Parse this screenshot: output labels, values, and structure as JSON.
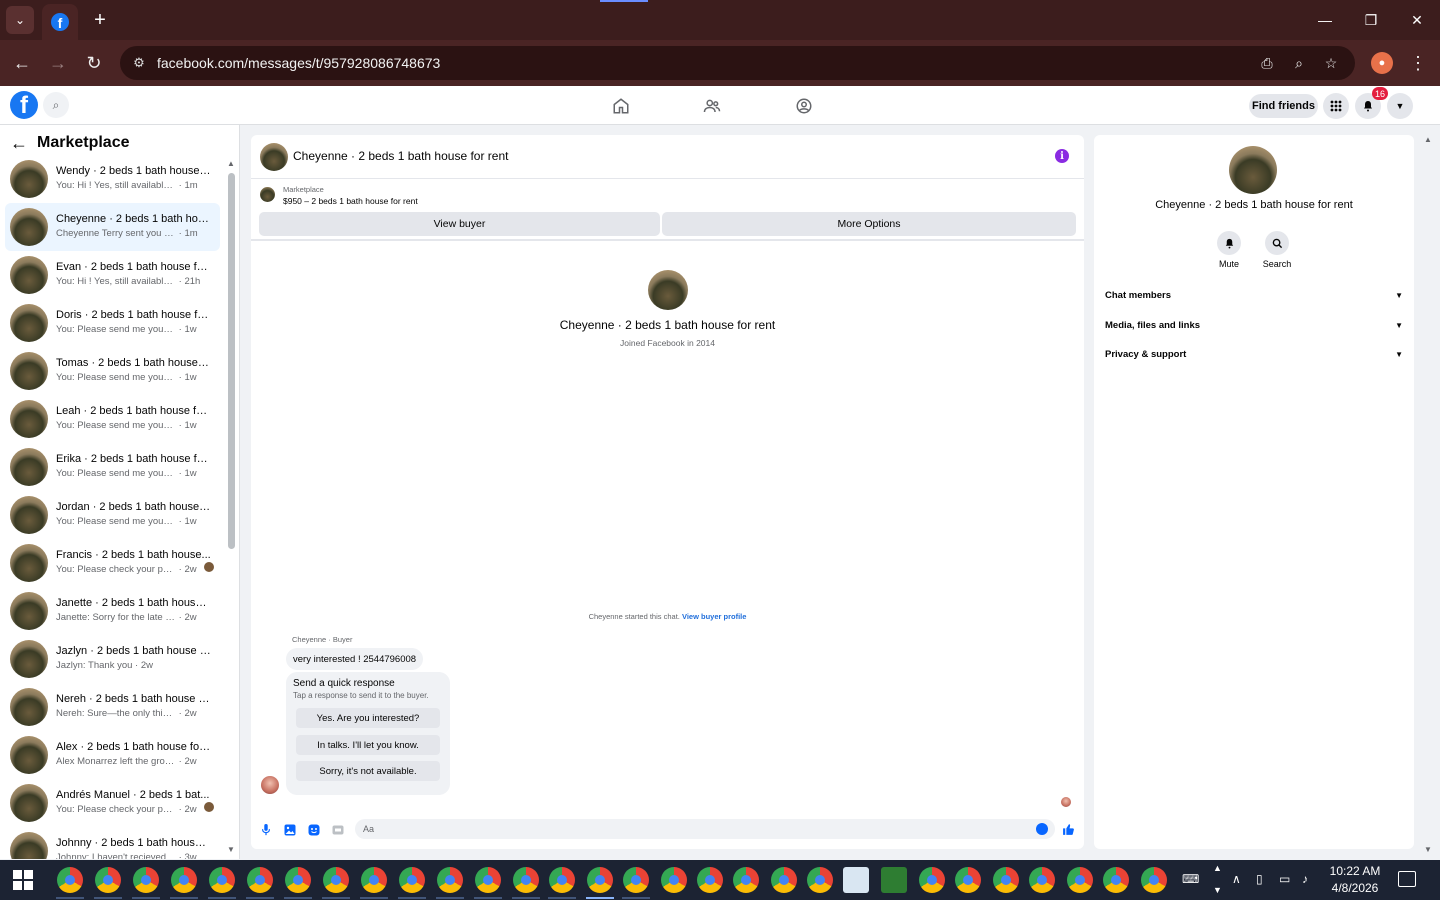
{
  "browser": {
    "url": "facebook.com/messages/t/957928086748673"
  },
  "fb": {
    "find_friends": "Find friends",
    "notification_count": "16"
  },
  "left": {
    "title": "Marketplace",
    "conversations": [
      {
        "title": "Wendy · 2 beds 1 bath house fo...",
        "sub": "You: Hi ! Yes, still available. If you'...",
        "time": "1m"
      },
      {
        "title": "Cheyenne · 2 beds 1 bath hous...",
        "sub": "Cheyenne Terry sent you a messa...",
        "time": "1m"
      },
      {
        "title": "Evan · 2 beds 1 bath house for r...",
        "sub": "You: Hi ! Yes, still available. If you'...",
        "time": "21h"
      },
      {
        "title": "Doris · 2 beds 1 bath house for ...",
        "sub": "You: Please send me your phone ...",
        "time": "1w"
      },
      {
        "title": "Tomas · 2 beds 1 bath house fo...",
        "sub": "You: Please send me your phone ...",
        "time": "1w"
      },
      {
        "title": "Leah · 2 beds 1 bath house for r...",
        "sub": "You: Please send me your phone ...",
        "time": "1w"
      },
      {
        "title": "Erika · 2 beds 1 bath house for r...",
        "sub": "You: Please send me your phone ...",
        "time": "1w"
      },
      {
        "title": "Jordan · 2 beds 1 bath house fo...",
        "sub": "You: Please send me your phone ...",
        "time": "1w"
      },
      {
        "title": "Francis · 2 beds 1 bath house...",
        "sub": "You: Please check your phone, ...",
        "time": "2w"
      },
      {
        "title": "Janette · 2 beds 1 bath house f...",
        "sub": "Janette: Sorry for the late respons...",
        "time": "2w"
      },
      {
        "title": "Jazlyn · 2 beds 1 bath house for...",
        "sub": "Jazlyn: Thank you",
        "time": "2w"
      },
      {
        "title": "Nereh · 2 beds 1 bath house for...",
        "sub": "Nereh: Sure—the only thing is th...",
        "time": "2w"
      },
      {
        "title": "Alex · 2 beds 1 bath house for r...",
        "sub": "Alex Monarrez left the group.",
        "time": "2w"
      },
      {
        "title": "Andrés Manuel · 2 beds 1 bat...",
        "sub": "You: Please check your phone, ...",
        "time": "2w"
      },
      {
        "title": "Johnny · 2 beds 1 bath house f...",
        "sub": "Johnny: I haven't recieved a mess...",
        "time": "3w"
      }
    ]
  },
  "chat": {
    "title": "Cheyenne · 2 beds 1 bath house for rent",
    "listing_label": "Marketplace",
    "listing_price": "$950 – 2 beds 1 bath house for rent",
    "view_buyer": "View buyer",
    "more_options": "More Options",
    "profile_name": "Cheyenne · 2 beds 1 bath house for rent",
    "joined": "Joined Facebook in 2014",
    "started_text": "Cheyenne started this chat.",
    "view_buyer_profile": "View buyer profile",
    "sender": "Cheyenne · Buyer",
    "message": "very interested ! 2544796008",
    "quick_title": "Send a quick response",
    "quick_sub": "Tap a response to send it to the buyer.",
    "quick_responses": [
      "Yes. Are you interested?",
      "In talks. I'll let you know.",
      "Sorry, it's not available."
    ],
    "composer_placeholder": "Aa"
  },
  "right": {
    "name": "Cheyenne · 2 beds 1 bath house for rent",
    "mute": "Mute",
    "search": "Search",
    "sections": [
      "Chat members",
      "Media, files and links",
      "Privacy & support"
    ]
  },
  "taskbar": {
    "time": "10:22 AM",
    "date": "4/8/2026"
  },
  "colors": {
    "fb_blue": "#1877f2",
    "messenger_blue": "#0866ff",
    "info_purple": "#8a2be2",
    "browser_frame": "#3c1d1d"
  }
}
